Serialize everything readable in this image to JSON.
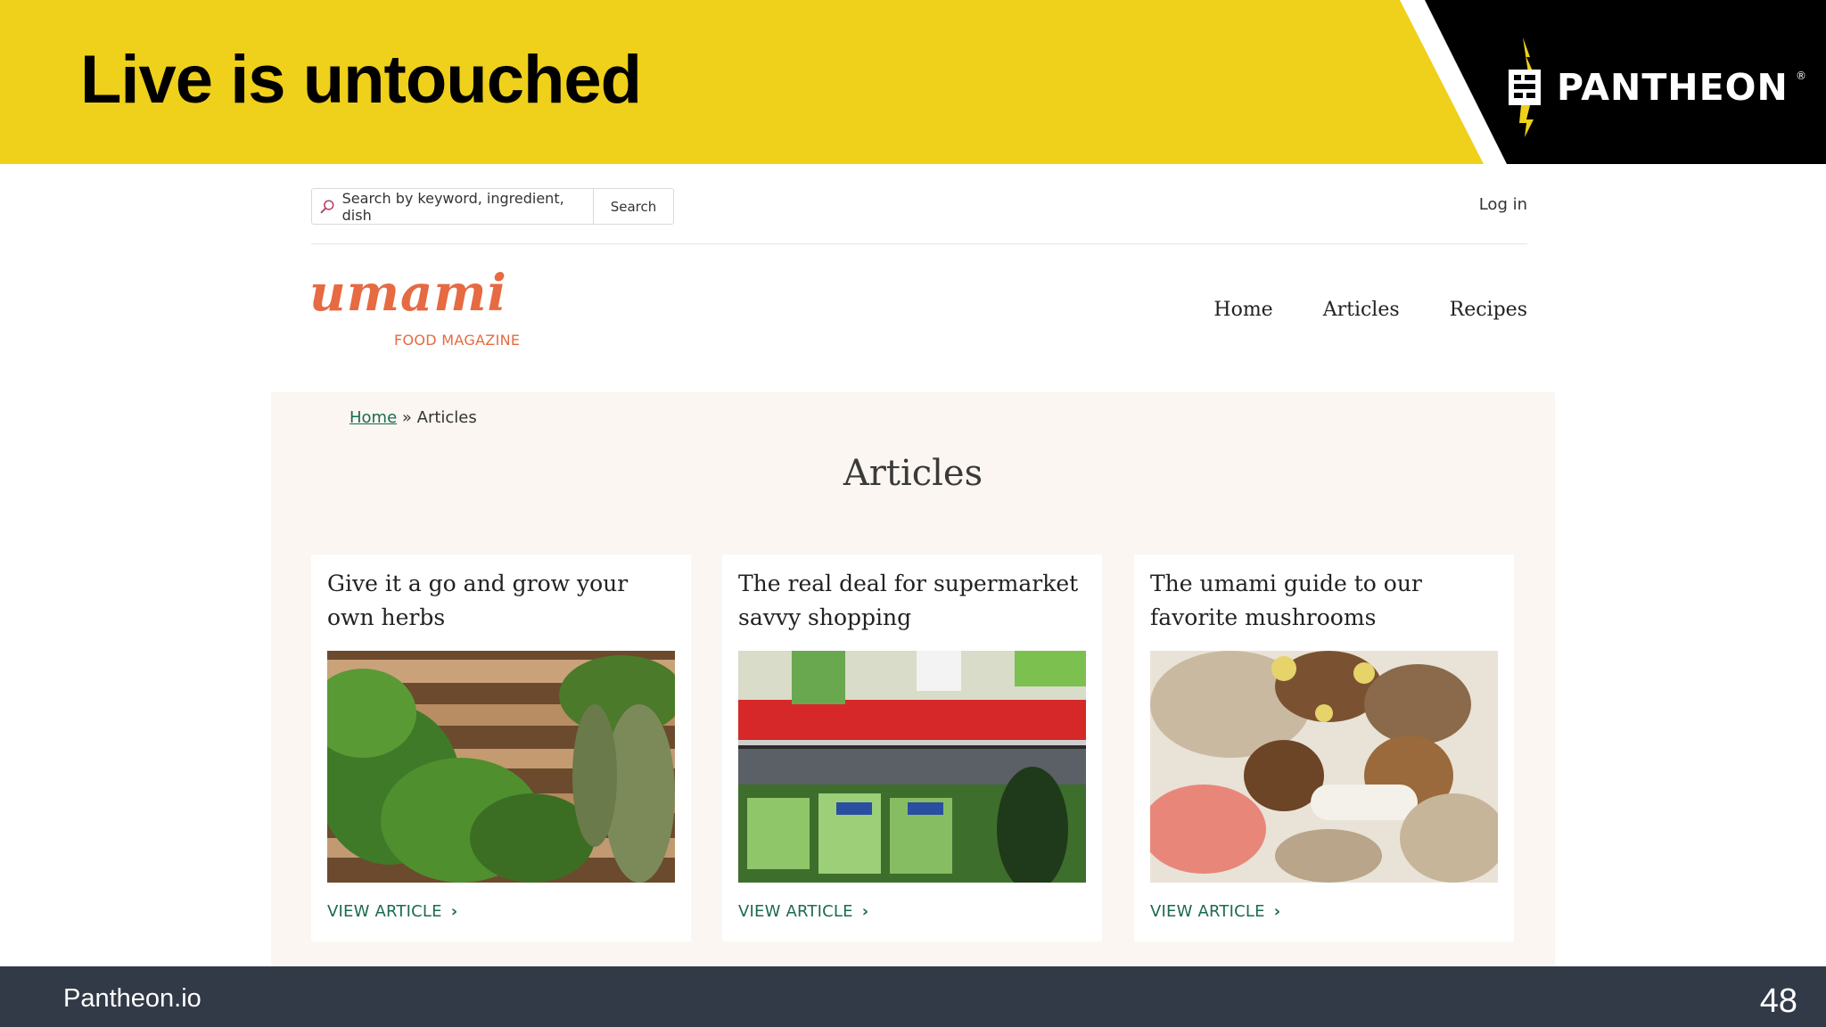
{
  "slide": {
    "title": "Live is untouched",
    "brand_name": "PANTHEON",
    "brand_registered": "®",
    "footer_site": "Pantheon.io",
    "slide_number": "48",
    "colors": {
      "header_yellow": "#efd01b",
      "header_black": "#000000",
      "footer": "#323a47"
    }
  },
  "site": {
    "search": {
      "placeholder": "Search by keyword, ingredient, dish",
      "button_label": "Search"
    },
    "login_label": "Log in",
    "logo": {
      "wordmark": "umami",
      "tagline": "FOOD MAGAZINE"
    },
    "nav": [
      "Home",
      "Articles",
      "Recipes"
    ],
    "breadcrumb": {
      "home": "Home",
      "separator": "»",
      "current": "Articles"
    },
    "page_heading": "Articles",
    "articles": [
      {
        "title": "Give it a go and grow your own herbs",
        "image": "herbs-photo",
        "link_label": "VIEW ARTICLE",
        "link_icon": "›"
      },
      {
        "title": "The real deal for supermarket savvy shopping",
        "image": "supermarket-photo",
        "link_label": "VIEW ARTICLE",
        "link_icon": "›"
      },
      {
        "title": "The umami guide to our favorite mushrooms",
        "image": "mushrooms-photo",
        "link_label": "VIEW ARTICLE",
        "link_icon": "›"
      }
    ],
    "colors": {
      "accent_orange": "#e66a42",
      "link_green": "#1b6a52",
      "content_bg": "#fbf6f1"
    }
  }
}
